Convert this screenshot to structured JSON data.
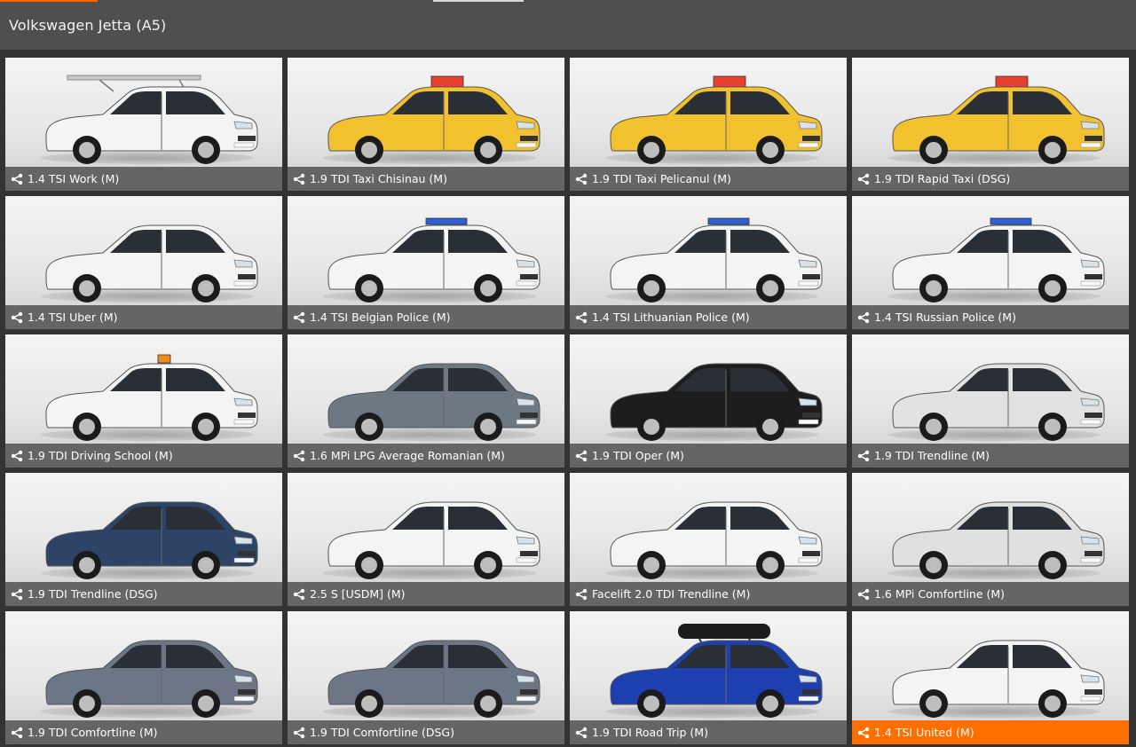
{
  "header": {
    "title": "Volkswagen Jetta (A5)"
  },
  "configs": [
    {
      "label": "1.4 TSI Work (M)",
      "body": "#f4f4f4",
      "extra": "ladder"
    },
    {
      "label": "1.9 TDI Taxi Chisinau (M)",
      "body": "#f2c12e",
      "extra": "taxi-sign"
    },
    {
      "label": "1.9 TDI Taxi Pelicanul (M)",
      "body": "#f2c12e",
      "extra": "taxi-sign"
    },
    {
      "label": "1.9 TDI Rapid Taxi (DSG)",
      "body": "#f2c12e",
      "extra": "taxi-sign"
    },
    {
      "label": "1.4 TSI Uber (M)",
      "body": "#f4f4f4",
      "extra": "none"
    },
    {
      "label": "1.4 TSI Belgian Police (M)",
      "body": "#f4f4f4",
      "extra": "lightbar"
    },
    {
      "label": "1.4 TSI Lithuanian Police (M)",
      "body": "#f4f4f4",
      "extra": "lightbar"
    },
    {
      "label": "1.4 TSI Russian Police (M)",
      "body": "#f4f4f4",
      "extra": "lightbar"
    },
    {
      "label": "1.9 TDI Driving School (M)",
      "body": "#f4f4f4",
      "extra": "beacon"
    },
    {
      "label": "1.6 MPi LPG Average Romanian (M)",
      "body": "#6e7882",
      "extra": "none"
    },
    {
      "label": "1.9 TDI Oper (M)",
      "body": "#1d1d1d",
      "extra": "none"
    },
    {
      "label": "1.9 TDI Trendline (M)",
      "body": "#e2e2e2",
      "extra": "none"
    },
    {
      "label": "1.9 TDI Trendline (DSG)",
      "body": "#2e4466",
      "extra": "none"
    },
    {
      "label": "2.5 S [USDM] (M)",
      "body": "#f4f4f4",
      "extra": "none"
    },
    {
      "label": "Facelift 2.0 TDI Trendline (M)",
      "body": "#f4f4f4",
      "extra": "none"
    },
    {
      "label": "1.6 MPi Comfortline (M)",
      "body": "#e0e0e0",
      "extra": "none"
    },
    {
      "label": "1.9 TDI Comfortline (M)",
      "body": "#6c7686",
      "extra": "none"
    },
    {
      "label": "1.9 TDI Comfortline (DSG)",
      "body": "#6c7686",
      "extra": "none"
    },
    {
      "label": "1.9 TDI Road Trip (M)",
      "body": "#1e3fb0",
      "extra": "roofbox"
    },
    {
      "label": "1.4 TSI United (M)",
      "body": "#f4f4f4",
      "extra": "none",
      "selected": true
    }
  ],
  "colors": {
    "accent": "#ff6f00",
    "caption_bg": "#5c5c5c",
    "header_bg": "#4f4f4f",
    "page_bg": "#333333"
  }
}
